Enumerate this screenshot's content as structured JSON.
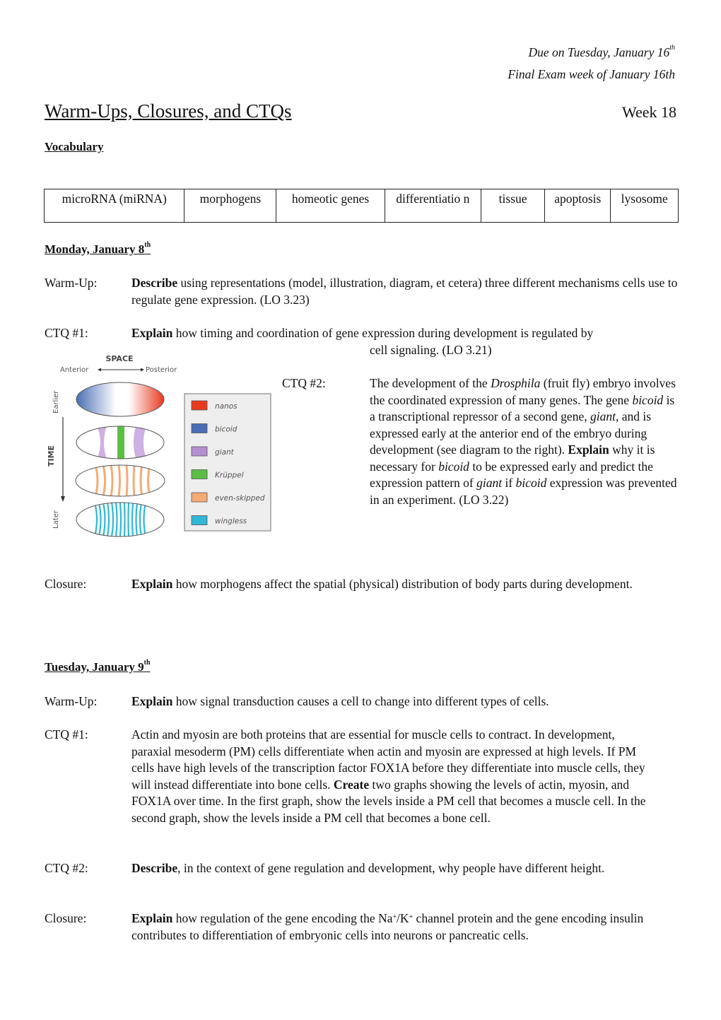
{
  "header": {
    "due_line": "Due on Tuesday, January 16",
    "due_sup": "th",
    "exam_line": "Final Exam week of January 16th",
    "title": "Warm-Ups, Closures, and CTQs",
    "week": "Week 18"
  },
  "vocabulary": {
    "heading": "Vocabulary",
    "terms": [
      "microRNA (miRNA)",
      "morphogens",
      "homeotic genes",
      "differentiatio n",
      "tissue",
      "apoptosis",
      "lysosome"
    ]
  },
  "monday": {
    "heading": "Monday, January 8",
    "heading_sup": "th",
    "warmup": {
      "label": "Warm-Up:",
      "verb": "Describe",
      "text": " using representations (model, illustration, diagram, et cetera) three different mechanisms cells use to regulate gene expression. (LO 3.23)"
    },
    "ctq1": {
      "label": "CTQ #1:",
      "verb": "Explain",
      "text_line1": " how timing and coordination of gene expression during development is regulated by",
      "text_line2": "cell signaling. (LO 3.21)"
    },
    "ctq2": {
      "label": "CTQ #2:",
      "t1": "The development of the ",
      "i1": "Drosphila",
      "t2": " (fruit fly) embryo involves the coordinated expression of many genes. The gene ",
      "i2": "bicoid",
      "t3": " is a transcriptional repressor of a second gene, ",
      "i3": "giant",
      "t4": ", and is expressed early at the anterior end of the embryo during development (see diagram to the right).  ",
      "verb": "Explain",
      "t5": " why it is necessary for ",
      "i4": "bicoid",
      "t6": " to be expressed early and predict the expression pattern of ",
      "i5": "giant",
      "t7": " if ",
      "i6": "bicoid",
      "t8": " expression was prevented in an experiment. (LO 3.22)"
    },
    "closure": {
      "label": "Closure:",
      "verb": "Explain",
      "text": " how morphogens affect the spatial (physical) distribution of body parts during development."
    }
  },
  "diagram": {
    "space_label": "SPACE",
    "anterior": "Anterior",
    "posterior": "Posterior",
    "time_label": "TIME",
    "earlier": "Earlier",
    "later": "Later",
    "legend": [
      {
        "name": "nanos",
        "color": "#e8391f"
      },
      {
        "name": "bicoid",
        "color": "#4a6fb5"
      },
      {
        "name": "giant",
        "color": "#b48fd0"
      },
      {
        "name": "Krüppel",
        "color": "#5cbf45"
      },
      {
        "name": "even-skipped",
        "color": "#f6ab73"
      },
      {
        "name": "wingless",
        "color": "#30b7d6"
      }
    ]
  },
  "tuesday": {
    "heading": "Tuesday, January 9",
    "heading_sup": "th",
    "warmup": {
      "label": "Warm-Up:",
      "verb": "Explain",
      "text": " how signal transduction causes a cell to change into different types of cells."
    },
    "ctq1": {
      "label": "CTQ #1:",
      "text1": "Actin and myosin are both proteins that are essential for muscle cells to contract.  In development, paraxial mesoderm (PM) cells differentiate when actin and myosin are expressed at high levels.  If PM cells have high levels of the transcription factor FOX1A before they differentiate into muscle cells, they will instead differentiate into bone cells. ",
      "verb": "Create",
      "text2": " two graphs showing the levels of actin, myosin, and FOX1A over time.  In the first graph, show the levels inside a PM cell that becomes a muscle cell.  In the second graph, show the levels inside a PM cell that becomes a bone cell."
    },
    "ctq2": {
      "label": "CTQ #2:",
      "verb": "Describe",
      "text": ", in the context of gene regulation and development, why people have different height."
    },
    "closure": {
      "label": "Closure:",
      "verb": "Explain",
      "t1": " how regulation of the gene encoding the Na",
      "sup1": "+",
      "t2": "/K",
      "sup2": "+",
      "t3": " channel protein and the gene encoding insulin contributes to differentiation of embryonic cells into neurons or pancreatic cells."
    }
  }
}
